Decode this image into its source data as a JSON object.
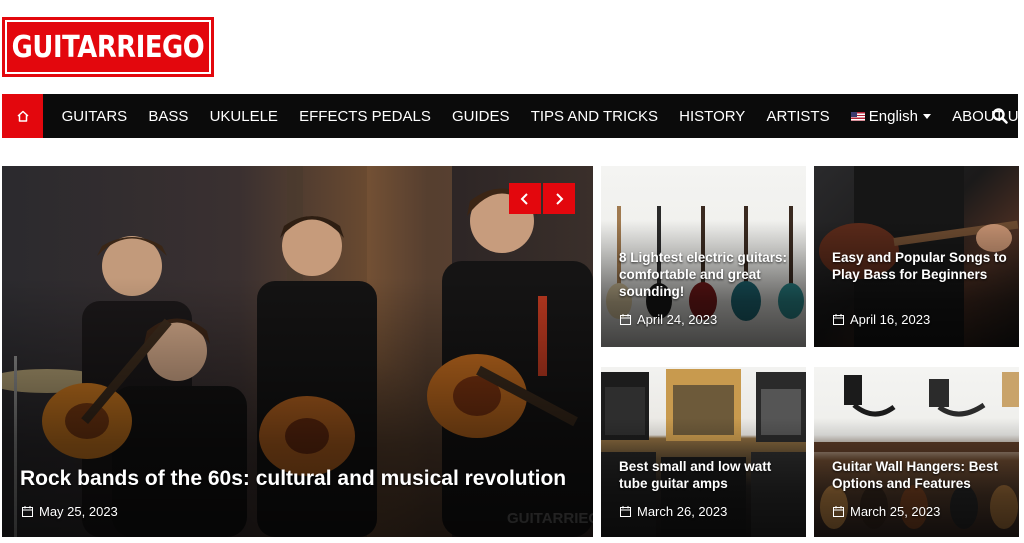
{
  "logo": {
    "text": "GUITARRIEGO"
  },
  "nav": {
    "items": [
      {
        "label": "GUITARS"
      },
      {
        "label": "BASS"
      },
      {
        "label": "UKULELE"
      },
      {
        "label": "EFFECTS PEDALS"
      },
      {
        "label": "GUIDES"
      },
      {
        "label": "TIPS AND TRICKS"
      },
      {
        "label": "HISTORY"
      },
      {
        "label": "ARTISTS"
      }
    ],
    "language": "English",
    "about": "ABOUT US",
    "icons": {
      "home": "home-icon",
      "search": "search-icon",
      "language": "us-flag-icon",
      "caret": "caret-down-icon"
    }
  },
  "featured": {
    "title": "Rock bands of the 60s: cultural and musical revolution",
    "date": "May 25, 2023"
  },
  "posts": [
    {
      "title": "8 Lightest electric guitars: comfortable and great sounding!",
      "date": "April 24, 2023"
    },
    {
      "title": "Easy and Popular Songs to Play Bass for Beginners",
      "date": "April 16, 2023"
    },
    {
      "title": "Best small and low watt tube guitar amps",
      "date": "March 26, 2023"
    },
    {
      "title": "Guitar Wall Hangers: Best Options and Features",
      "date": "March 25, 2023"
    }
  ],
  "colors": {
    "accent": "#e3070d",
    "nav_bg": "#0b0b0b",
    "text": "#ffffff"
  }
}
